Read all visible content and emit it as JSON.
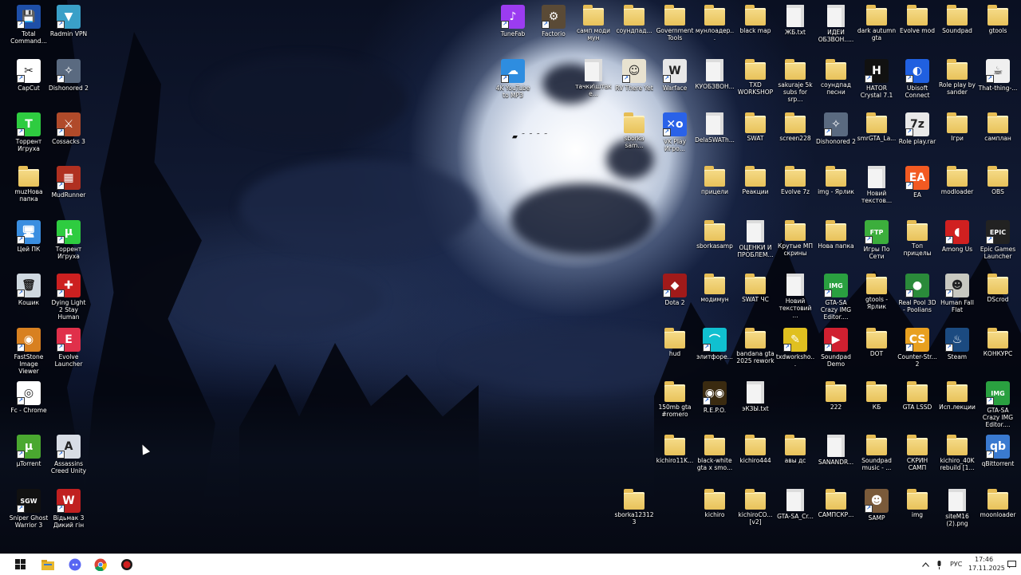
{
  "icons": [
    {
      "label": "Total Command...",
      "type": "app",
      "color": "#1e4fa8",
      "glyph": "💾"
    },
    {
      "label": "Radmin VPN",
      "type": "app",
      "color": "#3aa0c8",
      "glyph": "▼"
    },
    {
      "label": "CapCut",
      "type": "app",
      "color": "#ffffff",
      "glyph": "✂"
    },
    {
      "label": "Dishonored 2",
      "type": "app",
      "color": "#5a6a80",
      "glyph": "✧"
    },
    {
      "label": "Торрент Игруха",
      "type": "app",
      "color": "#2ecc40",
      "glyph": "T"
    },
    {
      "label": "Cossacks 3",
      "type": "app",
      "color": "#b04a2a",
      "glyph": "⚔"
    },
    {
      "label": "muzНова папка",
      "type": "folder"
    },
    {
      "label": "MudRunner",
      "type": "app",
      "color": "#b03020",
      "glyph": "▦"
    },
    {
      "label": "Цей ПК",
      "type": "app",
      "color": "#3a8ee0",
      "glyph": "🖥"
    },
    {
      "label": "Торрент Игруха",
      "type": "app",
      "color": "#2ecc40",
      "glyph": "µ"
    },
    {
      "label": "Кошик",
      "type": "app",
      "color": "#cfd8e0",
      "glyph": "🗑"
    },
    {
      "label": "Dying Light 2 Stay Human",
      "type": "app",
      "color": "#cc2020",
      "glyph": "✚"
    },
    {
      "label": "FastStone Image Viewer",
      "type": "app",
      "color": "#d88020",
      "glyph": "◉"
    },
    {
      "label": "Evolve Launcher",
      "type": "app",
      "color": "#e0304a",
      "glyph": "E"
    },
    {
      "label": "Fc - Chrome",
      "type": "app",
      "color": "#ffffff",
      "glyph": "◎"
    },
    {
      "label": "µTorrent",
      "type": "app",
      "color": "#4aa830",
      "glyph": "µ"
    },
    {
      "label": "Assassins Creed Unity",
      "type": "app",
      "color": "#d8dde5",
      "glyph": "A"
    },
    {
      "label": "Sniper Ghost Warrior 3",
      "type": "app",
      "color": "#111111",
      "glyph": "SGW"
    },
    {
      "label": "Відьмак 3 Дикий гін",
      "type": "app",
      "color": "#c02020",
      "glyph": "W"
    },
    {
      "label": "TuneFab",
      "type": "app",
      "color": "#9b3cf0",
      "glyph": "♪"
    },
    {
      "label": "Factorio",
      "type": "app",
      "color": "#5a4a36",
      "glyph": "⚙"
    },
    {
      "label": "самп моди мун",
      "type": "folder"
    },
    {
      "label": "соундпад...",
      "type": "folder"
    },
    {
      "label": "Government Tools",
      "type": "folder"
    },
    {
      "label": "мунлоадер...",
      "type": "folder"
    },
    {
      "label": "black map",
      "type": "folder"
    },
    {
      "label": "ЖБ.txt",
      "type": "file"
    },
    {
      "label": "ИДЕИ ОБЗВОН.....",
      "type": "file"
    },
    {
      "label": "dark autumn gta",
      "type": "folder"
    },
    {
      "label": "Evolve mod",
      "type": "folder"
    },
    {
      "label": "Soundpad",
      "type": "folder"
    },
    {
      "label": "gtools",
      "type": "folder"
    },
    {
      "label": "4K YouTube to MP3",
      "type": "app",
      "color": "#2e8de0",
      "glyph": "☁"
    },
    {
      "label": "тачки\\штаке...",
      "type": "file"
    },
    {
      "label": "RV There Yet",
      "type": "app",
      "color": "#e8e2d0",
      "glyph": "☺"
    },
    {
      "label": "Warface",
      "type": "app",
      "color": "#e8e8e8",
      "glyph": "W"
    },
    {
      "label": "КУОБЗВОН...",
      "type": "file"
    },
    {
      "label": "TXD WORKSHOP",
      "type": "folder"
    },
    {
      "label": "sakuraje 5k subs for srp...",
      "type": "folder"
    },
    {
      "label": "соундпад песни",
      "type": "folder"
    },
    {
      "label": "HATOR Crystal 7.1",
      "type": "app",
      "color": "#111111",
      "glyph": "H"
    },
    {
      "label": "Ubisoft Connect",
      "type": "app",
      "color": "#2060e0",
      "glyph": "◐"
    },
    {
      "label": "Role play by sander",
      "type": "folder"
    },
    {
      "label": "That-thing-...",
      "type": "app",
      "color": "#f0f0f0",
      "glyph": "☕"
    },
    {
      "label": "sborka sam...",
      "type": "folder"
    },
    {
      "label": "VK Play Игро...",
      "type": "app",
      "color": "#2a62e8",
      "glyph": "✕o"
    },
    {
      "label": "DelaSWATh...",
      "type": "file"
    },
    {
      "label": "SWAT",
      "type": "folder"
    },
    {
      "label": "screen228",
      "type": "folder"
    },
    {
      "label": "Dishonored 2",
      "type": "app",
      "color": "#5a6a80",
      "glyph": "✧"
    },
    {
      "label": "smrGTA_La...",
      "type": "folder"
    },
    {
      "label": "Role play.rar",
      "type": "app",
      "color": "#e8e8e8",
      "glyph": "7z"
    },
    {
      "label": "Ігри",
      "type": "folder"
    },
    {
      "label": "самплан",
      "type": "folder"
    },
    {
      "label": "прицели",
      "type": "folder"
    },
    {
      "label": "Реакции",
      "type": "folder"
    },
    {
      "label": "Evolve 7z",
      "type": "folder"
    },
    {
      "label": "img - Ярлик",
      "type": "folder"
    },
    {
      "label": "Новий текстов...",
      "type": "file"
    },
    {
      "label": "EA",
      "type": "app",
      "color": "#f25a22",
      "glyph": "EA"
    },
    {
      "label": "modloader",
      "type": "folder"
    },
    {
      "label": "OBS",
      "type": "folder"
    },
    {
      "label": "sborkasamp",
      "type": "folder"
    },
    {
      "label": "ОЦЕНКИ И ПРОБЛЕМ...",
      "type": "file"
    },
    {
      "label": "Крутые МП скрины",
      "type": "folder"
    },
    {
      "label": "Нова папка",
      "type": "folder"
    },
    {
      "label": "Игры По Сети",
      "type": "app",
      "color": "#3cae3c",
      "glyph": "FTP"
    },
    {
      "label": "Топ прицелы",
      "type": "folder"
    },
    {
      "label": "Among Us",
      "type": "app",
      "color": "#d02020",
      "glyph": "◖"
    },
    {
      "label": "Epic Games Launcher",
      "type": "app",
      "color": "#222222",
      "glyph": "EPIC"
    },
    {
      "label": "Dota 2",
      "type": "app",
      "color": "#a01a1a",
      "glyph": "◆"
    },
    {
      "label": "модимун",
      "type": "folder"
    },
    {
      "label": "SWAT ЧС",
      "type": "folder"
    },
    {
      "label": "Новий текстовий ...",
      "type": "file"
    },
    {
      "label": "GTA-SA Crazy IMG Editor....",
      "type": "app",
      "color": "#2aa040",
      "glyph": "IMG"
    },
    {
      "label": "gtools - Ярлик",
      "type": "folder"
    },
    {
      "label": "Real Pool 3D - Poolians",
      "type": "app",
      "color": "#2a8a3a",
      "glyph": "●"
    },
    {
      "label": "Human Fall Flat",
      "type": "app",
      "color": "#c8c8c0",
      "glyph": "☻"
    },
    {
      "label": "DScrod",
      "type": "folder"
    },
    {
      "label": "hud",
      "type": "folder"
    },
    {
      "label": "элитфоре...",
      "type": "app",
      "color": "#10c0d0",
      "glyph": "⌒"
    },
    {
      "label": "bandana gta 2025 rework",
      "type": "folder"
    },
    {
      "label": "txdworksho...",
      "type": "app",
      "color": "#e0c020",
      "glyph": "✎"
    },
    {
      "label": "Soundpad Demo",
      "type": "app",
      "color": "#d02030",
      "glyph": "▶"
    },
    {
      "label": "DOT",
      "type": "folder"
    },
    {
      "label": "Counter-Str... 2",
      "type": "app",
      "color": "#e8a020",
      "glyph": "CS"
    },
    {
      "label": "Steam",
      "type": "app",
      "color": "#1b4a80",
      "glyph": "♨"
    },
    {
      "label": "КОНКУРС",
      "type": "folder"
    },
    {
      "label": "150mb gta #romero",
      "type": "folder"
    },
    {
      "label": "R.E.P.O.",
      "type": "app",
      "color": "#3a2a10",
      "glyph": "◉◉"
    },
    {
      "label": "эК3Ы.txt",
      "type": "file"
    },
    {
      "label": "222",
      "type": "folder"
    },
    {
      "label": "КБ",
      "type": "folder"
    },
    {
      "label": "GTA LSSD",
      "type": "folder"
    },
    {
      "label": "Исп.лекции",
      "type": "folder"
    },
    {
      "label": "GTA-SA Crazy IMG Editor....",
      "type": "app",
      "color": "#2aa040",
      "glyph": "IMG"
    },
    {
      "label": "kichiro11K...",
      "type": "folder"
    },
    {
      "label": "black-white gta x smo...",
      "type": "folder"
    },
    {
      "label": "kichiro444",
      "type": "folder"
    },
    {
      "label": "авы дс",
      "type": "folder"
    },
    {
      "label": "SANANDR...",
      "type": "file"
    },
    {
      "label": "Soundpad music - ...",
      "type": "folder"
    },
    {
      "label": "СКРИН САМП",
      "type": "folder"
    },
    {
      "label": "kichiro_40K rebuild [1...",
      "type": "folder"
    },
    {
      "label": "qBittorrent",
      "type": "app",
      "color": "#3a7ad0",
      "glyph": "qb"
    },
    {
      "label": "sborka123123",
      "type": "folder"
    },
    {
      "label": "kichiro",
      "type": "folder"
    },
    {
      "label": "kichiroCO... [v2]",
      "type": "folder"
    },
    {
      "label": "GTA-SA_Cr...",
      "type": "file"
    },
    {
      "label": "САМПСКР...",
      "type": "folder"
    },
    {
      "label": "SAMP",
      "type": "app",
      "color": "#7a5a3a",
      "glyph": "☻"
    },
    {
      "label": "img",
      "type": "folder"
    },
    {
      "label": "siteM16 (2).png",
      "type": "file"
    },
    {
      "label": "moonloader",
      "type": "folder"
    }
  ],
  "taskbar": {
    "start_label": "Start",
    "apps": [
      {
        "name": "file-explorer",
        "glyph": "📁",
        "color": "#e8b830"
      },
      {
        "name": "discord",
        "glyph": "◕",
        "color": "#5865f2"
      },
      {
        "name": "chrome",
        "glyph": "◎",
        "color": "#2a9a3a"
      },
      {
        "name": "app",
        "glyph": "●",
        "color": "#d02020"
      }
    ],
    "lang": "РУС",
    "time": "17:46",
    "date": "17.11.2025"
  },
  "colors": {
    "folder": "#e8c25a",
    "taskbar": "#ffffff"
  }
}
